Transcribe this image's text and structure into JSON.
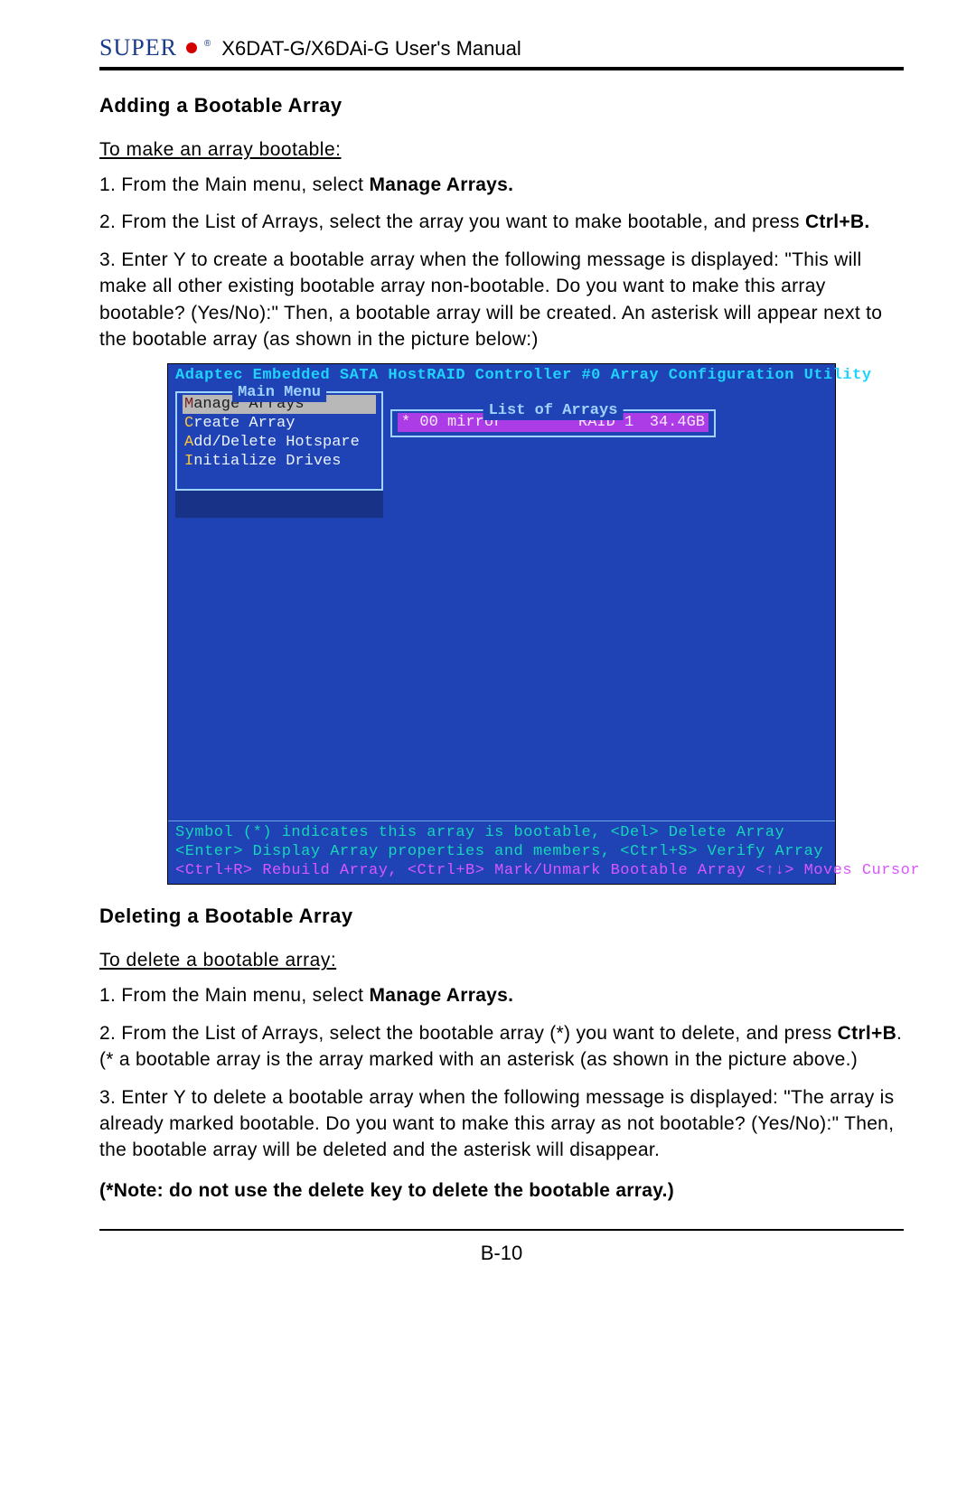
{
  "header": {
    "brand": "SUPER",
    "title": "X6DAT-G/X6DAi-G User's Manual"
  },
  "section1": {
    "title": "Adding a Bootable Array",
    "intro": "To make an array bootable:",
    "p1a": "1. From the Main menu, select ",
    "p1b": "Manage Arrays.",
    "p2a": "2. From the List of Arrays, select the array you want to make bootable, and press ",
    "p2b": "Ctrl+B.",
    "p3": "3. Enter Y to create a bootable array when the following message is displayed: \"This will make all other existing bootable array non-bootable. Do you want to make this array bootable? (Yes/No):\"  Then, a bootable array will be created.  An asterisk will appear next to the bootable array (as shown in the picture below:)"
  },
  "bios": {
    "top_bar": "Adaptec Embedded SATA HostRAID Controller #0 Array Configuration Utility",
    "main_menu_title": "Main Menu",
    "menu": {
      "m1_hot": "M",
      "m1": "anage Arrays",
      "m2_hot": "C",
      "m2": "reate Array",
      "m3_hot": "A",
      "m3": "dd/Delete Hotspare",
      "m4_hot": "I",
      "m4": "nitialize Drives"
    },
    "arr_title": "List of Arrays",
    "arr_row": {
      "name": "* 00 mirror",
      "raid": "RAID 1",
      "size": "34.4GB"
    },
    "help1": "Symbol (*) indicates this array is bootable, <Del> Delete Array",
    "help2": "<Enter> Display Array properties and members, <Ctrl+S> Verify Array",
    "help3": "<Ctrl+R> Rebuild Array, <Ctrl+B> Mark/Unmark Bootable Array <↑↓> Moves Cursor"
  },
  "section2": {
    "title": "Deleting a Bootable Array",
    "intro": "To delete a bootable array:",
    "p1a": "1. From the Main menu, select ",
    "p1b": "Manage Arrays.",
    "p2a": "2. From the List of Arrays, select the bootable array (*) you want to delete, and press ",
    "p2b": "Ctrl+B",
    "p2c": ". (* a bootable array is the array marked with an asterisk (as shown in the picture above.)",
    "p3": "3. Enter Y to delete a bootable array when the following message is displayed: \"The array is already marked bootable. Do you want to make this array as not bootable? (Yes/No):\" Then,  the bootable array will be deleted and the asterisk will disappear.",
    "note": "(*Note: do not use the delete key to delete the bootable array.)"
  },
  "page_number": "B-10"
}
